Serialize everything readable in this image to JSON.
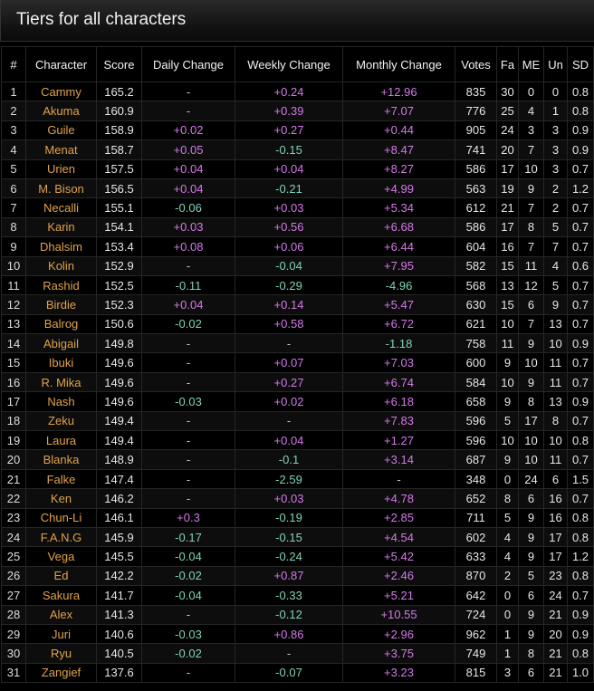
{
  "title": "Tiers for all characters",
  "headers": [
    "#",
    "Character",
    "Score",
    "Daily Change",
    "Weekly Change",
    "Monthly Change",
    "Votes",
    "Fa",
    "ME",
    "Un",
    "SD"
  ],
  "colors": {
    "character": "#e0a24a",
    "positive": "#d479e8",
    "negative": "#7fd3b6"
  },
  "rows": [
    [
      "1",
      "Cammy",
      "165.2",
      "-",
      "+0.24",
      "+12.96",
      "835",
      "30",
      "0",
      "0",
      "0.8"
    ],
    [
      "2",
      "Akuma",
      "160.9",
      "-",
      "+0.39",
      "+7.07",
      "776",
      "25",
      "4",
      "1",
      "0.8"
    ],
    [
      "3",
      "Guile",
      "158.9",
      "+0.02",
      "+0.27",
      "+0.44",
      "905",
      "24",
      "3",
      "3",
      "0.9"
    ],
    [
      "4",
      "Menat",
      "158.7",
      "+0.05",
      "-0.15",
      "+8.47",
      "741",
      "20",
      "7",
      "3",
      "0.9"
    ],
    [
      "5",
      "Urien",
      "157.5",
      "+0.04",
      "+0.04",
      "+8.27",
      "586",
      "17",
      "10",
      "3",
      "0.7"
    ],
    [
      "6",
      "M. Bison",
      "156.5",
      "+0.04",
      "-0.21",
      "+4.99",
      "563",
      "19",
      "9",
      "2",
      "1.2"
    ],
    [
      "7",
      "Necalli",
      "155.1",
      "-0.06",
      "+0.03",
      "+5.34",
      "612",
      "21",
      "7",
      "2",
      "0.7"
    ],
    [
      "8",
      "Karin",
      "154.1",
      "+0.03",
      "+0.56",
      "+6.68",
      "586",
      "17",
      "8",
      "5",
      "0.7"
    ],
    [
      "9",
      "Dhalsim",
      "153.4",
      "+0.08",
      "+0.06",
      "+6.44",
      "604",
      "16",
      "7",
      "7",
      "0.7"
    ],
    [
      "10",
      "Kolin",
      "152.9",
      "-",
      "-0.04",
      "+7.95",
      "582",
      "15",
      "11",
      "4",
      "0.6"
    ],
    [
      "11",
      "Rashid",
      "152.5",
      "-0.11",
      "-0.29",
      "-4.96",
      "568",
      "13",
      "12",
      "5",
      "0.7"
    ],
    [
      "12",
      "Birdie",
      "152.3",
      "+0.04",
      "+0.14",
      "+5.47",
      "630",
      "15",
      "6",
      "9",
      "0.7"
    ],
    [
      "13",
      "Balrog",
      "150.6",
      "-0.02",
      "+0.58",
      "+6.72",
      "621",
      "10",
      "7",
      "13",
      "0.7"
    ],
    [
      "14",
      "Abigail",
      "149.8",
      "-",
      "-",
      "-1.18",
      "758",
      "11",
      "9",
      "10",
      "0.9"
    ],
    [
      "15",
      "Ibuki",
      "149.6",
      "-",
      "+0.07",
      "+7.03",
      "600",
      "9",
      "10",
      "11",
      "0.7"
    ],
    [
      "16",
      "R. Mika",
      "149.6",
      "-",
      "+0.27",
      "+6.74",
      "584",
      "10",
      "9",
      "11",
      "0.7"
    ],
    [
      "17",
      "Nash",
      "149.6",
      "-0.03",
      "+0.02",
      "+6.18",
      "658",
      "9",
      "8",
      "13",
      "0.9"
    ],
    [
      "18",
      "Zeku",
      "149.4",
      "-",
      "-",
      "+7.83",
      "596",
      "5",
      "17",
      "8",
      "0.7"
    ],
    [
      "19",
      "Laura",
      "149.4",
      "-",
      "+0.04",
      "+1.27",
      "596",
      "10",
      "10",
      "10",
      "0.8"
    ],
    [
      "20",
      "Blanka",
      "148.9",
      "-",
      "-0.1",
      "+3.14",
      "687",
      "9",
      "10",
      "11",
      "0.7"
    ],
    [
      "21",
      "Falke",
      "147.4",
      "-",
      "-2.59",
      "-",
      "348",
      "0",
      "24",
      "6",
      "1.5"
    ],
    [
      "22",
      "Ken",
      "146.2",
      "-",
      "+0.03",
      "+4.78",
      "652",
      "8",
      "6",
      "16",
      "0.7"
    ],
    [
      "23",
      "Chun-Li",
      "146.1",
      "+0.3",
      "-0.19",
      "+2.85",
      "711",
      "5",
      "9",
      "16",
      "0.8"
    ],
    [
      "24",
      "F.A.N.G",
      "145.9",
      "-0.17",
      "-0.15",
      "+4.54",
      "602",
      "4",
      "9",
      "17",
      "0.8"
    ],
    [
      "25",
      "Vega",
      "145.5",
      "-0.04",
      "-0.24",
      "+5.42",
      "633",
      "4",
      "9",
      "17",
      "1.2"
    ],
    [
      "26",
      "Ed",
      "142.2",
      "-0.02",
      "+0.87",
      "+2.46",
      "870",
      "2",
      "5",
      "23",
      "0.8"
    ],
    [
      "27",
      "Sakura",
      "141.7",
      "-0.04",
      "-0.33",
      "+5.21",
      "642",
      "0",
      "6",
      "24",
      "0.7"
    ],
    [
      "28",
      "Alex",
      "141.3",
      "-",
      "-0.12",
      "+10.55",
      "724",
      "0",
      "9",
      "21",
      "0.9"
    ],
    [
      "29",
      "Juri",
      "140.6",
      "-0.03",
      "+0.86",
      "+2.96",
      "962",
      "1",
      "9",
      "20",
      "0.9"
    ],
    [
      "30",
      "Ryu",
      "140.5",
      "-0.02",
      "-",
      "+3.75",
      "749",
      "1",
      "8",
      "21",
      "0.8"
    ],
    [
      "31",
      "Zangief",
      "137.6",
      "-",
      "-0.07",
      "+3.23",
      "815",
      "3",
      "6",
      "21",
      "1.0"
    ]
  ]
}
